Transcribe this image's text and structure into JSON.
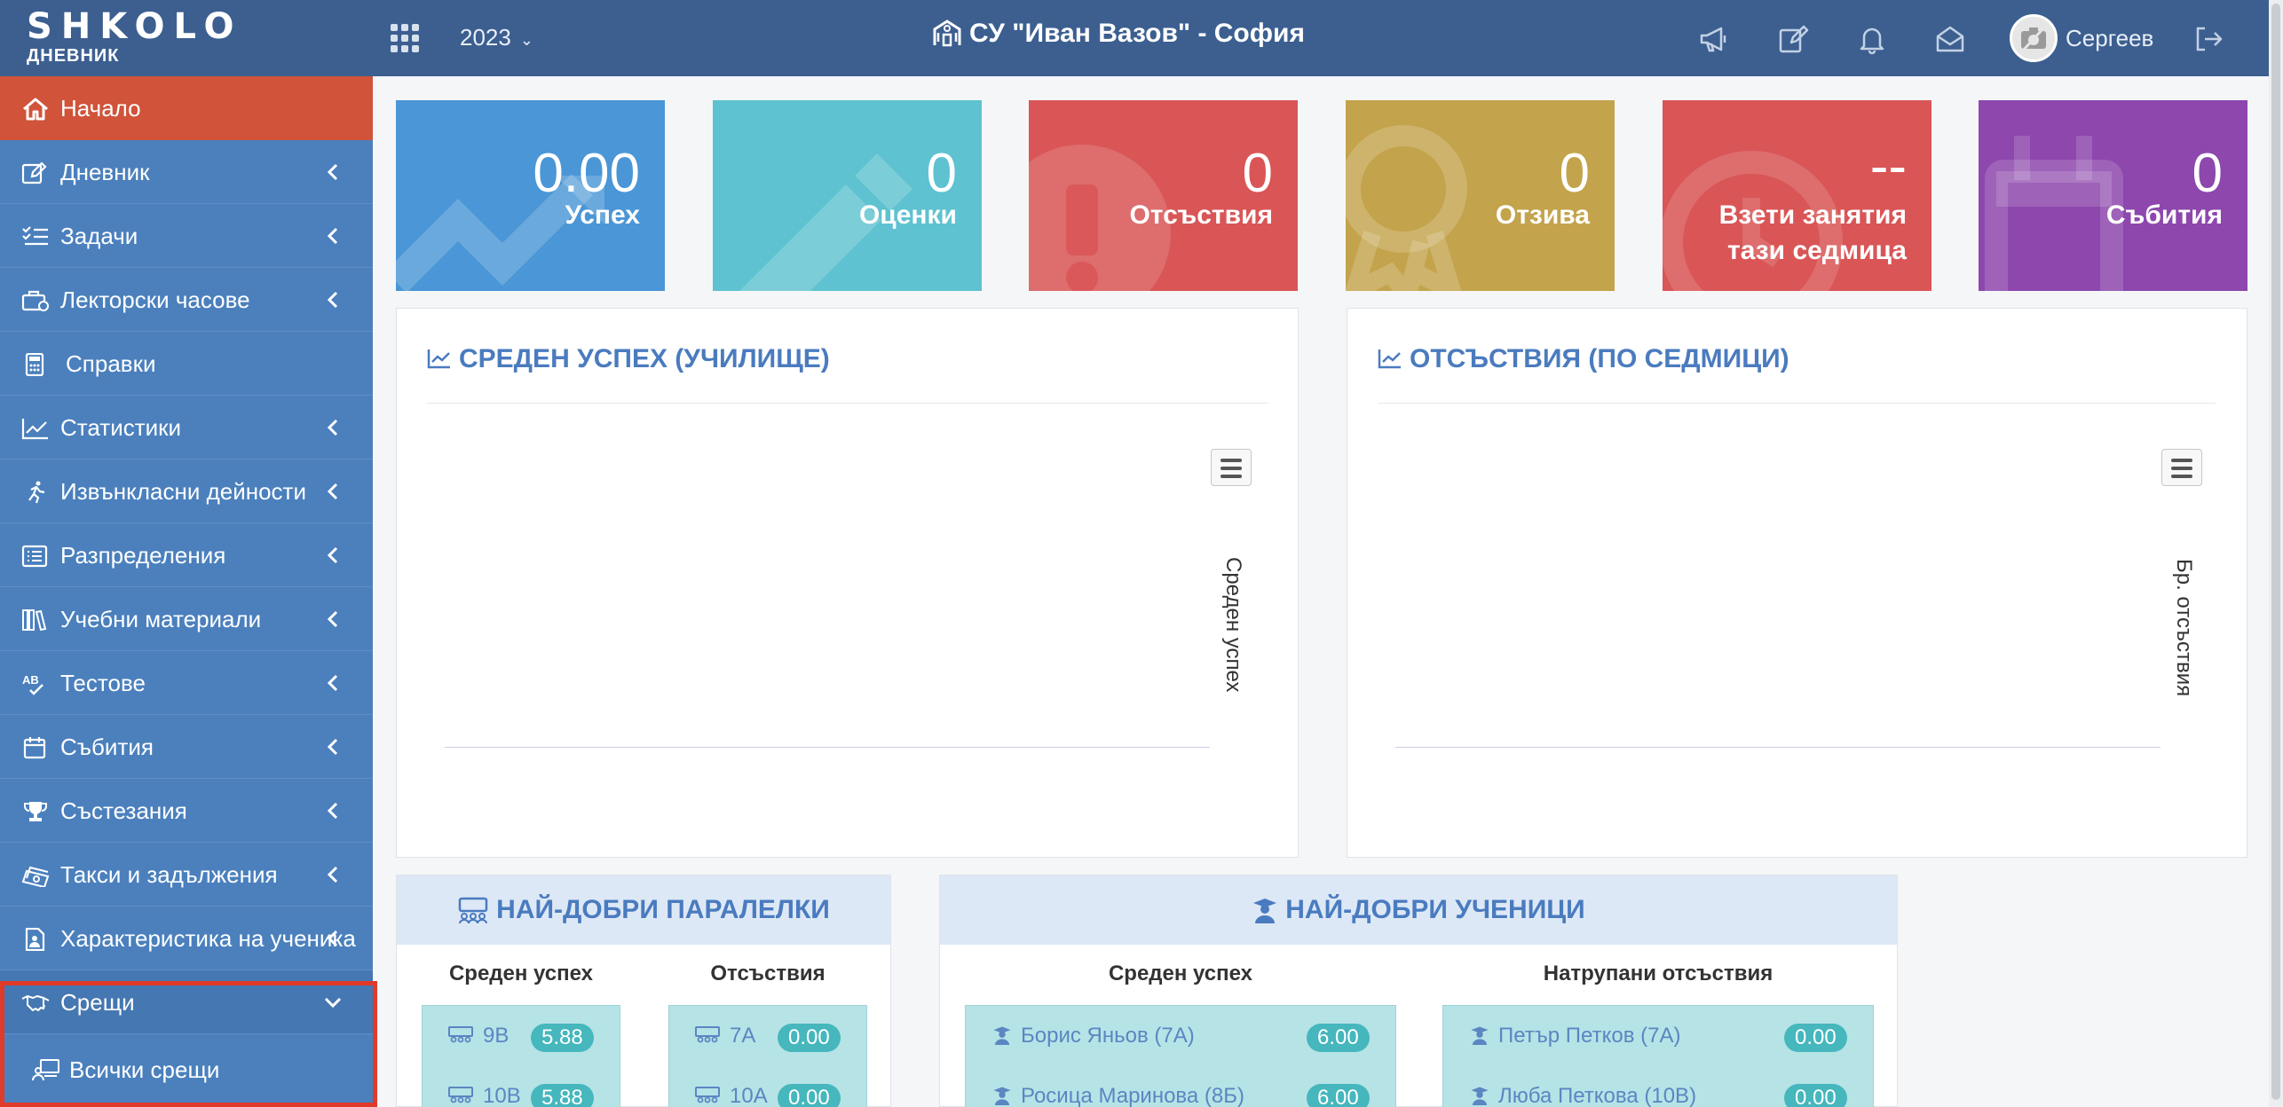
{
  "app": {
    "logo": "SHKOLO",
    "logo_sub": "ДНЕВНИК",
    "year": "2023",
    "school": "СУ \"Иван Вазов\" - София",
    "user": "Сергеев"
  },
  "sidebar": {
    "items": [
      {
        "label": "Начало",
        "icon": "home-icon"
      },
      {
        "label": "Дневник",
        "icon": "edit-icon"
      },
      {
        "label": "Задачи",
        "icon": "tasks-icon"
      },
      {
        "label": "Лекторски часове",
        "icon": "briefcase-icon"
      },
      {
        "label": "Справки",
        "icon": "calculator-icon"
      },
      {
        "label": "Статистики",
        "icon": "chart-line-icon"
      },
      {
        "label": "Извънкласни дейности",
        "icon": "running-icon"
      },
      {
        "label": "Разпределения",
        "icon": "list-icon"
      },
      {
        "label": "Учебни материали",
        "icon": "books-icon"
      },
      {
        "label": "Тестове",
        "icon": "spellcheck-icon"
      },
      {
        "label": "Събития",
        "icon": "calendar-icon"
      },
      {
        "label": "Състезания",
        "icon": "trophy-icon"
      },
      {
        "label": "Такси и задължения",
        "icon": "money-icon"
      },
      {
        "label": "Характеристика на ученика",
        "icon": "file-user-icon"
      },
      {
        "label": "Срещи",
        "icon": "handshake-icon"
      }
    ],
    "sub_items": [
      {
        "label": "Всички срещи",
        "icon": "meeting-icon"
      }
    ]
  },
  "tiles": [
    {
      "value": "0.00",
      "label": "Успех",
      "color": "#4a96d6"
    },
    {
      "value": "0",
      "label": "Оценки",
      "color": "#5ec2d0"
    },
    {
      "value": "0",
      "label": "Отсъствия",
      "color": "#d95556"
    },
    {
      "value": "0",
      "label": "Отзива",
      "color": "#c3a34b"
    },
    {
      "value": "--",
      "label": "Взети занятия",
      "label2": "тази седмица",
      "color": "#d95556"
    },
    {
      "value": "0",
      "label": "Събития",
      "color": "#8d47ad"
    }
  ],
  "charts": {
    "avg": {
      "title": "СРЕДЕН УСПЕХ (УЧИЛИЩЕ)",
      "ylabel": "Среден успех"
    },
    "abs": {
      "title": "ОТСЪСТВИЯ (ПО СЕДМИЦИ)",
      "ylabel": "Бр. отсъствия"
    }
  },
  "best_classes": {
    "title": "НАЙ-ДОБРИ ПАРАЛЕЛКИ",
    "col_avg": "Среден успех",
    "col_abs": "Отсъствия",
    "avg": [
      {
        "name": "9В",
        "value": "5.88"
      },
      {
        "name": "10В",
        "value": "5.88"
      }
    ],
    "abs": [
      {
        "name": "7А",
        "value": "0.00"
      },
      {
        "name": "10А",
        "value": "0.00"
      }
    ]
  },
  "best_students": {
    "title": "НАЙ-ДОБРИ УЧЕНИЦИ",
    "col_avg": "Среден успех",
    "col_abs": "Натрупани отсъствия",
    "avg": [
      {
        "name": "Борис Яньов (7А)",
        "value": "6.00"
      },
      {
        "name": "Росица Маринова (8Б)",
        "value": "6.00"
      }
    ],
    "abs": [
      {
        "name": "Петър Петков (7А)",
        "value": "0.00"
      },
      {
        "name": "Люба Петкова (10В)",
        "value": "0.00"
      }
    ]
  }
}
